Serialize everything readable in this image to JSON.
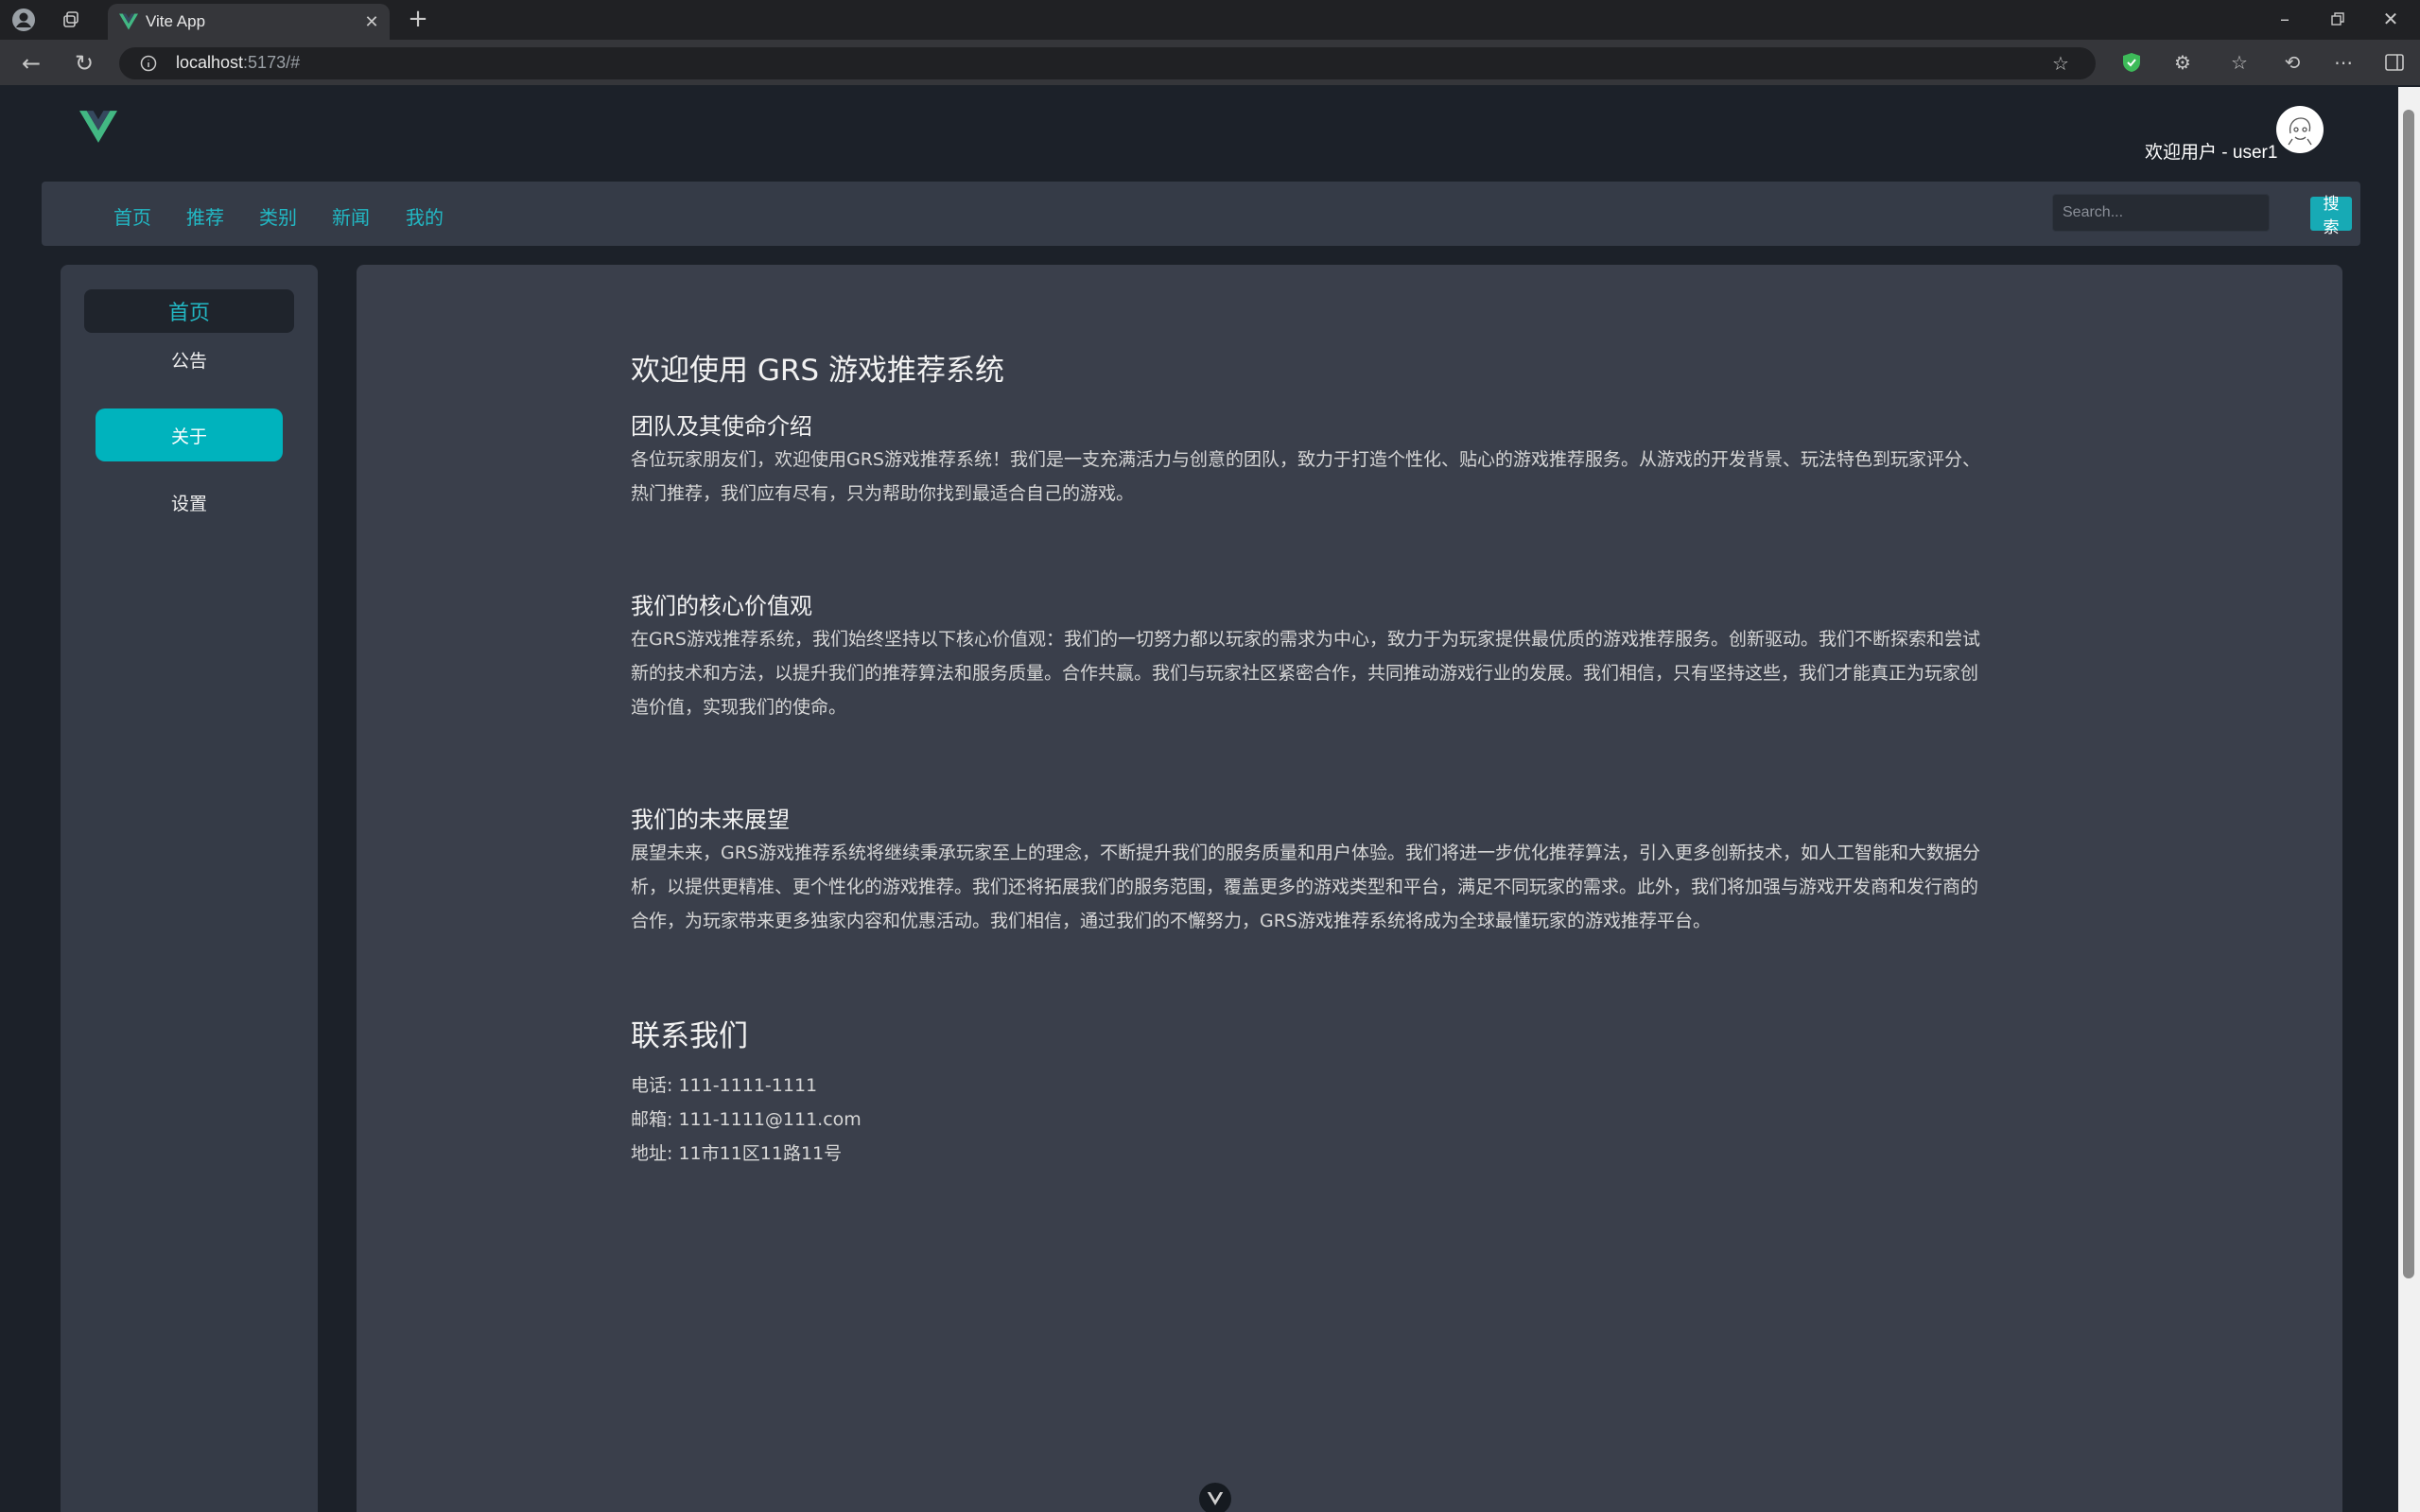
{
  "browser": {
    "tab_title": "Vite App",
    "url_host": "localhost",
    "url_rest": ":5173/#"
  },
  "header": {
    "welcome_text": "欢迎用户 - user1"
  },
  "nav": {
    "links": [
      "首页",
      "推荐",
      "类别",
      "新闻",
      "我的"
    ],
    "search_placeholder": "Search...",
    "search_button": "搜索"
  },
  "sidebar": {
    "home": "首页",
    "items": [
      "公告",
      "关于",
      "设置"
    ],
    "active": "关于"
  },
  "article": {
    "title": "欢迎使用 GRS 游戏推荐系统",
    "sections": [
      {
        "heading": "团队及其使命介绍",
        "lines": [
          "各位玩家朋友们，欢迎使用GRS游戏推荐系统！我们是一支充满活力与创意的团队，致力于打造个性化、贴心的游戏推荐服务。从游戏的开发背景、玩法特色到玩家评分、",
          "热门推荐，我们应有尽有，只为帮助你找到最适合自己的游戏。"
        ]
      },
      {
        "heading": "我们的核心价值观",
        "lines": [
          "在GRS游戏推荐系统，我们始终坚持以下核心价值观：我们的一切努力都以玩家的需求为中心，致力于为玩家提供最优质的游戏推荐服务。创新驱动。我们不断探索和尝试",
          "新的技术和方法，以提升我们的推荐算法和服务质量。合作共赢。我们与玩家社区紧密合作，共同推动游戏行业的发展。我们相信，只有坚持这些，我们才能真正为玩家创",
          "造价值，实现我们的使命。"
        ]
      },
      {
        "heading": "我们的未来展望",
        "lines": [
          "展望未来，GRS游戏推荐系统将继续秉承玩家至上的理念，不断提升我们的服务质量和用户体验。我们将进一步优化推荐算法，引入更多创新技术，如人工智能和大数据分",
          "析，以提供更精准、更个性化的游戏推荐。我们还将拓展我们的服务范围，覆盖更多的游戏类型和平台，满足不同玩家的需求。此外，我们将加强与游戏开发商和发行商的",
          "合作，为玩家带来更多独家内容和优惠活动。我们相信，通过我们的不懈努力，GRS游戏推荐系统将成为全球最懂玩家的游戏推荐平台。"
        ]
      }
    ]
  },
  "contact": {
    "title": "联系我们",
    "phone": "电话: 111-1111-1111",
    "email": "邮箱: 111-1111@111.com",
    "address": "地址: 11市11区11路11号"
  },
  "colors": {
    "accent": "#00b3bd",
    "link": "#22b8c4",
    "page_bg": "#1c2129",
    "panel_bg": "#3a3f4b",
    "vue_green": "#42b883",
    "vue_dark": "#35495e"
  }
}
